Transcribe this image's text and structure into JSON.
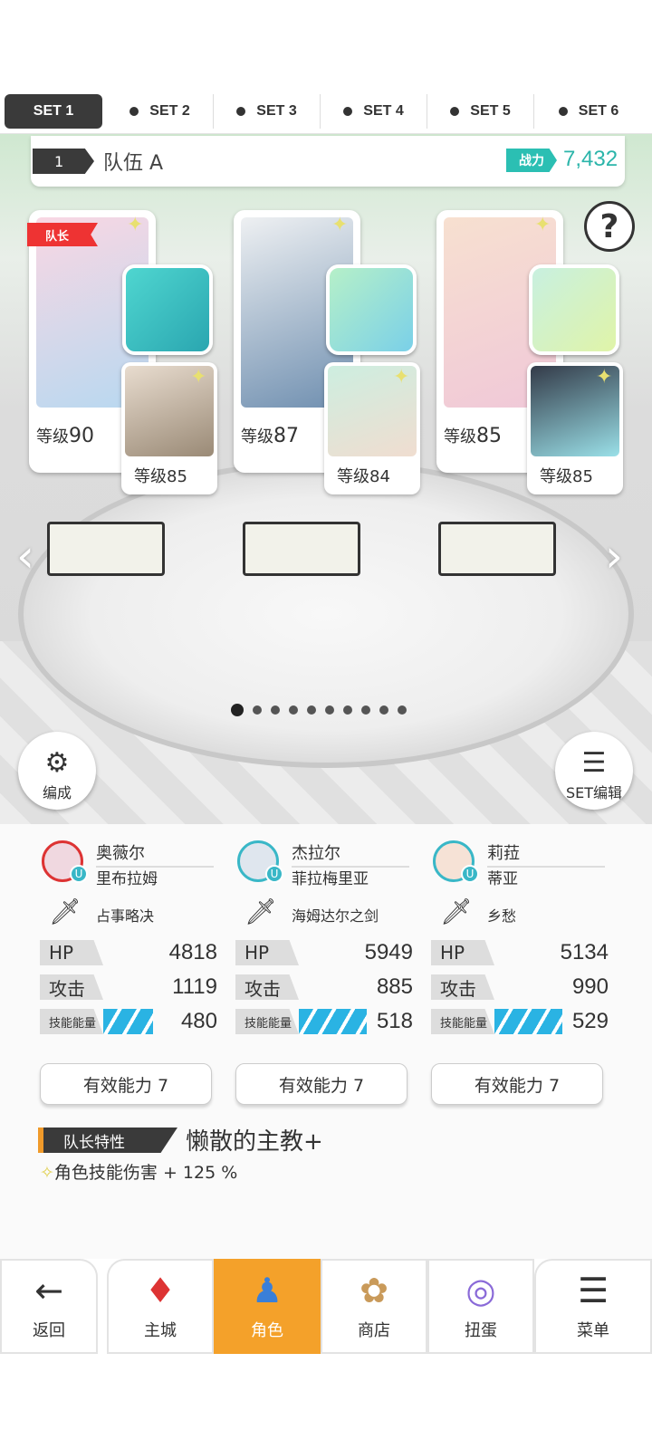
{
  "tabs": [
    {
      "label": "SET 1",
      "active": true
    },
    {
      "label": "SET 2"
    },
    {
      "label": "SET 3"
    },
    {
      "label": "SET 4"
    },
    {
      "label": "SET 5"
    },
    {
      "label": "SET 6"
    }
  ],
  "team": {
    "number": "1",
    "name": "队伍 A",
    "cp_label": "战力",
    "cp_value": "7,432"
  },
  "help_icon": "?",
  "leader_badge": "队长",
  "cards": [
    {
      "level": "等级",
      "level_num": "90",
      "sub_level": "等级",
      "sub_level_num": "85",
      "main_color": "#f5c9d6",
      "sub_color": "#c8b8a0",
      "weapon_color": "#3bc7c7",
      "weapon_icon": "console-icon"
    },
    {
      "level": "等级",
      "level_num": "87",
      "sub_level": "等级",
      "sub_level_num": "84",
      "main_color": "#d6dbe0",
      "sub_color": "#b8e0d0",
      "weapon_color": "#9be0c0",
      "weapon_icon": "sword-icon"
    },
    {
      "level": "等级",
      "level_num": "85",
      "sub_level": "等级",
      "sub_level_num": "85",
      "main_color": "#f5d8c6",
      "sub_color": "#3a4050",
      "weapon_color": "#a8e8d8",
      "weapon_icon": "helmet-icon"
    }
  ],
  "page_dots": {
    "count": 10,
    "active": 0
  },
  "buttons": {
    "formation": "编成",
    "set_edit": "SET编辑"
  },
  "characters": [
    {
      "name": "奥薇尔",
      "sub_name": "里布拉姆",
      "weapon": "占事略决",
      "hp_label": "HP",
      "hp": "4818",
      "atk_label": "攻击",
      "atk": "1119",
      "energy_label": "技能能量",
      "energy": "480",
      "energy_level": 0.55,
      "effect_button": "有效能力 7"
    },
    {
      "name": "杰拉尔",
      "sub_name": "菲拉梅里亚",
      "weapon": "海姆达尔之剑",
      "hp_label": "HP",
      "hp": "5949",
      "atk_label": "攻击",
      "atk": "885",
      "energy_label": "技能能量",
      "energy": "518",
      "energy_level": 0.75,
      "effect_button": "有效能力 7"
    },
    {
      "name": "莉菈",
      "sub_name": "蒂亚",
      "weapon": "乡愁",
      "hp_label": "HP",
      "hp": "5134",
      "atk_label": "攻击",
      "atk": "990",
      "energy_label": "技能能量",
      "energy": "529",
      "energy_level": 0.75,
      "effect_button": "有效能力 7"
    }
  ],
  "leader_skill": {
    "tag": "队长特性",
    "name": "懒散的主教+",
    "effect": "角色技能伤害 + 125 %"
  },
  "nav": [
    {
      "label": "返回",
      "icon": "back-arrow-icon",
      "glyph": "←"
    },
    {
      "label": "主城",
      "icon": "castle-icon",
      "glyph": "♦"
    },
    {
      "label": "角色",
      "icon": "character-icon",
      "glyph": "♟",
      "active": true
    },
    {
      "label": "商店",
      "icon": "shop-icon",
      "glyph": "✿"
    },
    {
      "label": "扭蛋",
      "icon": "gacha-icon",
      "glyph": "◎"
    },
    {
      "label": "菜单",
      "icon": "menu-icon",
      "glyph": "☰"
    }
  ],
  "colors": {
    "accent_teal": "#2bbfb3",
    "nav_active": "#f4a12a",
    "energy_blue": "#2ab3e3",
    "leader_red": "#e33333"
  }
}
